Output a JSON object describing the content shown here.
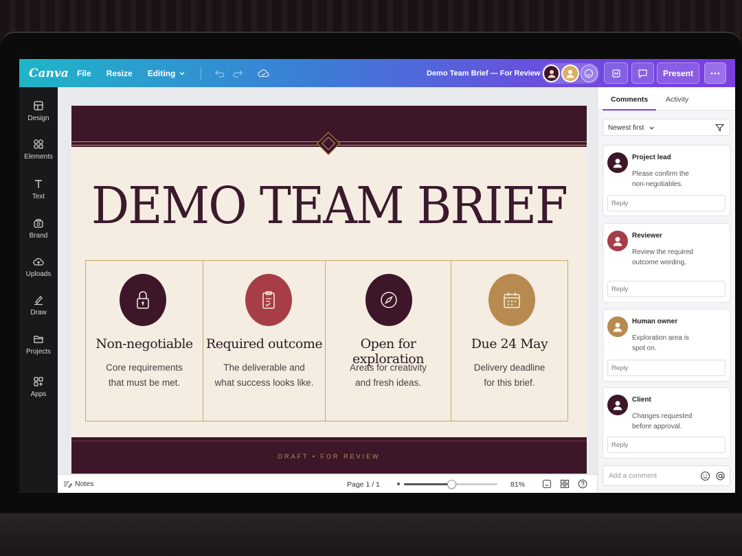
{
  "app": {
    "logo": "Canva",
    "doc_title": "Demo Team Brief — For Review"
  },
  "toolbar": {
    "file": "File",
    "resize": "Resize",
    "editing": "Editing",
    "present": "Present"
  },
  "rail": [
    {
      "label": "Design",
      "icon": "layout-icon"
    },
    {
      "label": "Elements",
      "icon": "shapes-icon"
    },
    {
      "label": "Text",
      "icon": "text-icon"
    },
    {
      "label": "Brand",
      "icon": "brand-icon"
    },
    {
      "label": "Uploads",
      "icon": "cloud-upload-icon"
    },
    {
      "label": "Draw",
      "icon": "pen-icon"
    },
    {
      "label": "Projects",
      "icon": "folder-icon"
    },
    {
      "label": "Apps",
      "icon": "apps-icon"
    }
  ],
  "slide": {
    "headline": "DEMO TEAM BRIEF",
    "footer": "DRAFT • FOR REVIEW",
    "cards": [
      {
        "title": "Non-negotiable",
        "desc1": "Core requirements",
        "desc2": "that must be met.",
        "icon": "lock-icon",
        "color": "#3d1629"
      },
      {
        "title": "Required outcome",
        "desc1": "The deliverable and",
        "desc2": "what success looks like.",
        "icon": "clipboard-check-icon",
        "color": "#a63d47"
      },
      {
        "title": "Open for exploration",
        "desc1": "Areas for creativity",
        "desc2": "and fresh ideas.",
        "icon": "compass-icon",
        "color": "#3d1629"
      },
      {
        "title": "Due 24 May",
        "desc1": "Delivery deadline",
        "desc2": "for this brief.",
        "icon": "calendar-icon",
        "color": "#b78a4f"
      }
    ]
  },
  "bottombar": {
    "notes": "Notes",
    "page": "Page 1 / 1",
    "zoom": "81%",
    "zoom_value": 0.51
  },
  "panel": {
    "tabs": [
      "Comments",
      "Activity"
    ],
    "sort": "Newest first",
    "comments": [
      {
        "name": "Project lead",
        "text1": "Please confirm the",
        "text2": "non-negotiables.",
        "reply": "Reply",
        "color": "#3d1629"
      },
      {
        "name": "Reviewer",
        "text1": "Review the required",
        "text2": "outcome wording.",
        "reply": "Reply",
        "color": "#a63d47"
      },
      {
        "name": "Human owner",
        "text1": "Exploration area is",
        "text2": "spot on.",
        "reply": "Reply",
        "color": "#b78a4f"
      },
      {
        "name": "Client",
        "text1": "Changes requested",
        "text2": "before approval.",
        "reply": "Reply",
        "color": "#3d1629"
      }
    ],
    "add_placeholder": "Add a comment"
  }
}
